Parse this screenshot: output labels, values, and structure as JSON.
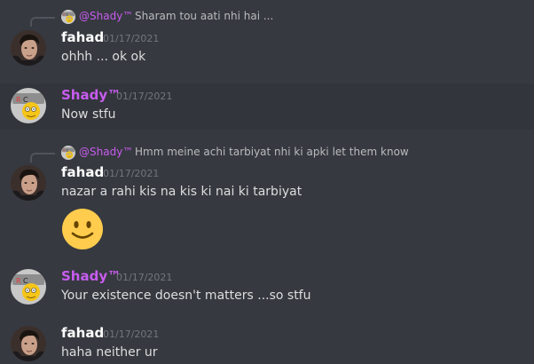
{
  "colors": {
    "background": "#36393f",
    "shady_name": "#c85cf0",
    "fahad_name": "#ffffff",
    "timestamp": "#72767d",
    "message_text": "#dcddde"
  },
  "messages": [
    {
      "reply": {
        "mention": "@Shady™",
        "text": "Sharam tou aati nhi hai ..."
      },
      "author": "fahad",
      "timestamp": "01/17/2021",
      "text": "ohhh ... ok ok",
      "avatar_icon": "fahad-avatar-icon"
    },
    {
      "author": "Shady™",
      "timestamp": "01/17/2021",
      "text": "Now stfu",
      "avatar_icon": "shady-avatar-icon"
    },
    {
      "reply": {
        "mention": "@Shady™",
        "text": "Hmm meine achi tarbiyat nhi ki apki let them know"
      },
      "author": "fahad",
      "timestamp": "01/17/2021",
      "text": "nazar a rahi kis na kis ki nai ki tarbiyat",
      "emoji": "slightly-smiling-face-emoji",
      "avatar_icon": "fahad-avatar-icon"
    },
    {
      "author": "Shady™",
      "timestamp": "01/17/2021",
      "text": "Your existence doesn't matters ...so stfu",
      "avatar_icon": "shady-avatar-icon"
    },
    {
      "author": "fahad",
      "timestamp": "01/17/2021",
      "text": "haha neither ur",
      "avatar_icon": "fahad-avatar-icon"
    }
  ]
}
